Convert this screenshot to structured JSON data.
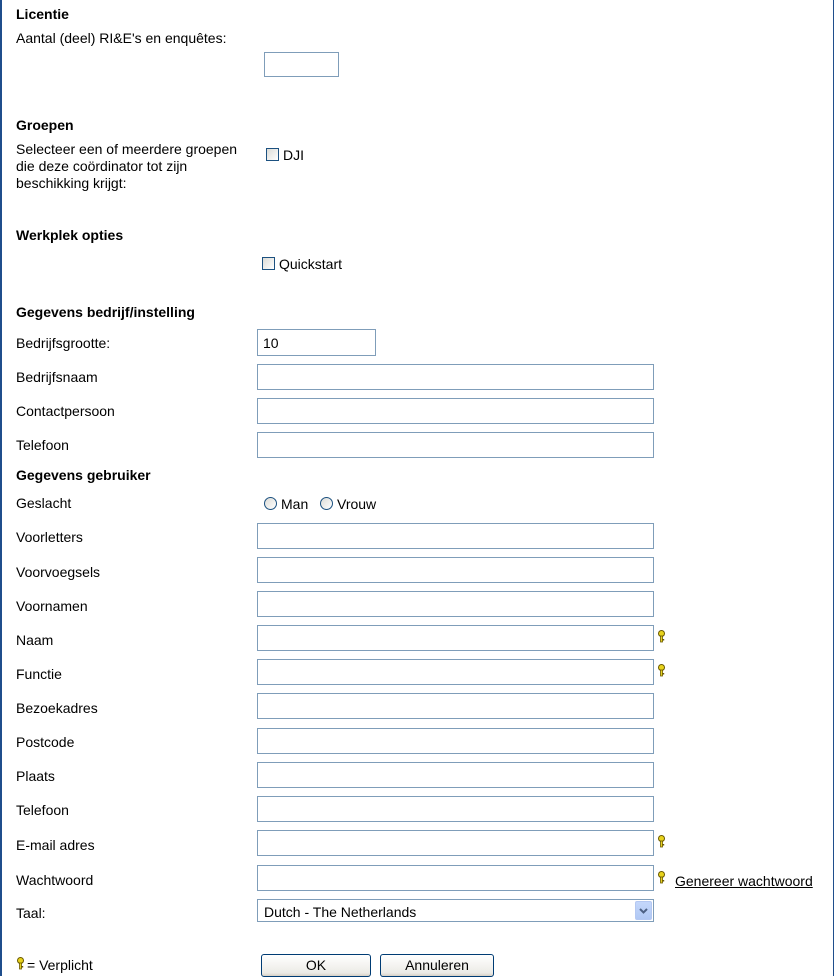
{
  "license": {
    "heading": "Licentie",
    "count_label": "Aantal (deel) RI&E's en enquêtes:",
    "count_value": ""
  },
  "groups": {
    "heading": "Groepen",
    "instruction": "Selecteer een of meerdere groepen die deze coördinator tot zijn beschikking krijgt:",
    "options": [
      {
        "label": "DJI",
        "checked": false
      }
    ]
  },
  "workplace": {
    "heading": "Werkplek opties",
    "quickstart_label": "Quickstart",
    "quickstart_checked": false
  },
  "company": {
    "heading": "Gegevens bedrijf/instelling",
    "size_label": "Bedrijfsgrootte:",
    "size_value": "10",
    "name_label": "Bedrijfsnaam",
    "contact_label": "Contactpersoon",
    "phone_label": "Telefoon"
  },
  "user": {
    "heading": "Gegevens gebruiker",
    "gender_label": "Geslacht",
    "gender_options": [
      "Man",
      "Vrouw"
    ],
    "initials_label": "Voorletters",
    "prefixes_label": "Voorvoegsels",
    "firstnames_label": "Voornamen",
    "lastname_label": "Naam",
    "function_label": "Functie",
    "visit_address_label": "Bezoekadres",
    "postcode_label": "Postcode",
    "city_label": "Plaats",
    "phone_label": "Telefoon",
    "email_label": "E-mail adres",
    "password_label": "Wachtwoord",
    "generate_password_link": "Genereer wachtwoord",
    "language_label": "Taal:",
    "language_value": "Dutch - The Netherlands"
  },
  "footer": {
    "required_legend": "= Verplicht",
    "ok_label": "OK",
    "cancel_label": "Annuleren"
  },
  "colors": {
    "key_icon": "#e8d31c",
    "frame": "#1f4e8c",
    "input_border": "#7f9db9"
  }
}
